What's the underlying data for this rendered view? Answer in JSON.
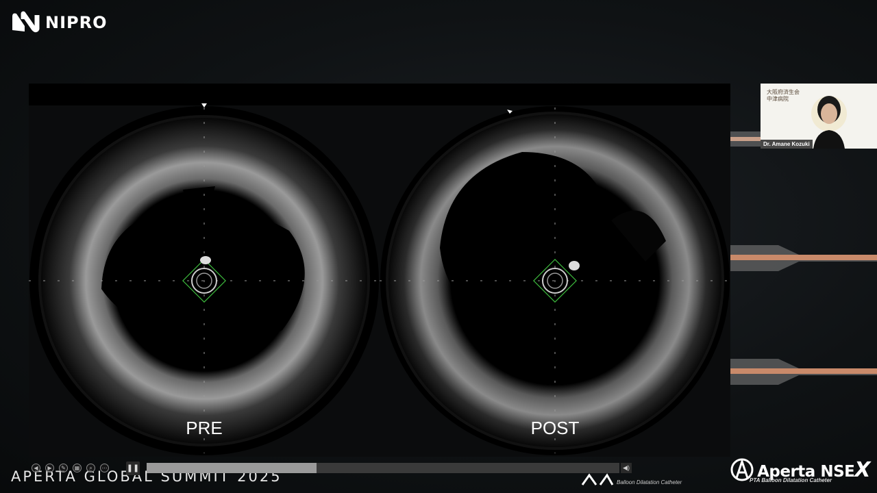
{
  "header": {
    "logo_text": "NIPRO"
  },
  "slide": {
    "panels": [
      {
        "label": "PRE"
      },
      {
        "label": "POST"
      }
    ]
  },
  "video_feed": {
    "org_line1": "大阪府済生会",
    "org_line2": "中津病院",
    "speaker_name": "Dr. Amane Kozuki"
  },
  "footer": {
    "event_title": "APERTA GLOBAL SUMMIT 2025",
    "brand_name": "Aperta NSE",
    "brand_suffix": "X",
    "brand_tagline": "PTA Balloon Dilatation Catheter",
    "brand_tagline_left": "Balloon Dilatation Catheter"
  },
  "player": {
    "progress": 0.36
  },
  "colors": {
    "marker_green": "#3dbb3d",
    "background": "#0f1214"
  }
}
